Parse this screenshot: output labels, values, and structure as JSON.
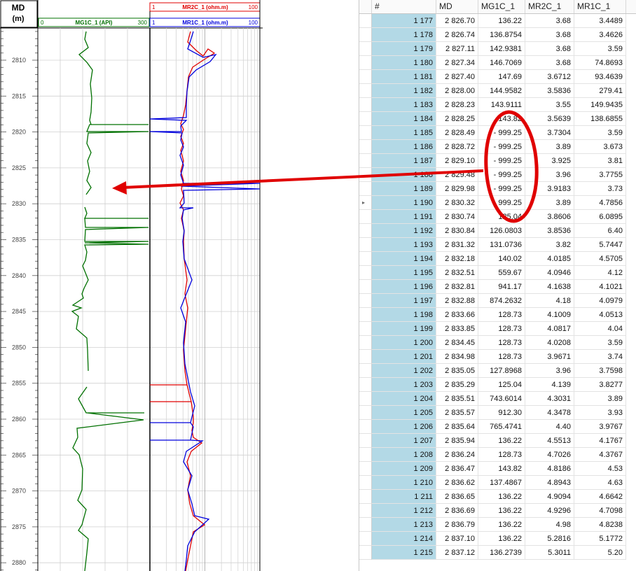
{
  "log": {
    "md_header": "MD",
    "md_unit": "(m)",
    "track1": {
      "min": "0",
      "name": "MG1C_1 (API)",
      "max": "300",
      "color": "#007000"
    },
    "track2_top": {
      "min": "1",
      "name": "MR2C_1 (ohm.m)",
      "max": "100",
      "color": "#e00000"
    },
    "track2_bottom": {
      "min": "1",
      "name": "MR1C_1 (ohm.m)",
      "max": "100",
      "color": "#0000dd"
    },
    "depth_labels": [
      "2810",
      "2815",
      "2820",
      "2825",
      "2830",
      "2835",
      "2840",
      "2845",
      "2850",
      "2855",
      "2860",
      "2865",
      "2870",
      "2875",
      "2880"
    ]
  },
  "table": {
    "columns": [
      "#",
      "MD",
      "MG1C_1",
      "MR2C_1",
      "MR1C_1"
    ],
    "current_row_marker": "▸",
    "rows": [
      [
        "1 177",
        "2 826.70",
        "136.22",
        "3.68",
        "3.4489"
      ],
      [
        "1 178",
        "2 826.74",
        "136.8754",
        "3.68",
        "3.4626"
      ],
      [
        "1 179",
        "2 827.11",
        "142.9381",
        "3.68",
        "3.59"
      ],
      [
        "1 180",
        "2 827.34",
        "146.7069",
        "3.68",
        "74.8693"
      ],
      [
        "1 181",
        "2 827.40",
        "147.69",
        "3.6712",
        "93.4639"
      ],
      [
        "1 182",
        "2 828.00",
        "144.9582",
        "3.5836",
        "279.41"
      ],
      [
        "1 183",
        "2 828.23",
        "143.9111",
        "3.55",
        "149.9435"
      ],
      [
        "1 184",
        "2 828.25",
        "143.82",
        "3.5639",
        "138.6855"
      ],
      [
        "1 185",
        "2 828.49",
        "- 999.25",
        "3.7304",
        "3.59"
      ],
      [
        "1 186",
        "2 828.72",
        "- 999.25",
        "3.89",
        "3.673"
      ],
      [
        "1 187",
        "2 829.10",
        "- 999.25",
        "3.925",
        "3.81"
      ],
      [
        "1 188",
        "2 829.48",
        "- 999.25",
        "3.96",
        "3.7755"
      ],
      [
        "1 189",
        "2 829.98",
        "- 999.25",
        "3.9183",
        "3.73"
      ],
      [
        "1 190",
        "2 830.32",
        "- 999.25",
        "3.89",
        "4.7856"
      ],
      [
        "1 191",
        "2 830.74",
        "125.04",
        "3.8606",
        "6.0895"
      ],
      [
        "1 192",
        "2 830.84",
        "126.0803",
        "3.8536",
        "6.40"
      ],
      [
        "1 193",
        "2 831.32",
        "131.0736",
        "3.82",
        "5.7447"
      ],
      [
        "1 194",
        "2 832.18",
        "140.02",
        "4.0185",
        "4.5705"
      ],
      [
        "1 195",
        "2 832.51",
        "559.67",
        "4.0946",
        "4.12"
      ],
      [
        "1 196",
        "2 832.81",
        "941.17",
        "4.1638",
        "4.1021"
      ],
      [
        "1 197",
        "2 832.88",
        "874.2632",
        "4.18",
        "4.0979"
      ],
      [
        "1 198",
        "2 833.66",
        "128.73",
        "4.1009",
        "4.0513"
      ],
      [
        "1 199",
        "2 833.85",
        "128.73",
        "4.0817",
        "4.04"
      ],
      [
        "1 200",
        "2 834.45",
        "128.73",
        "4.0208",
        "3.59"
      ],
      [
        "1 201",
        "2 834.98",
        "128.73",
        "3.9671",
        "3.74"
      ],
      [
        "1 202",
        "2 835.05",
        "127.8968",
        "3.96",
        "3.7598"
      ],
      [
        "1 203",
        "2 835.29",
        "125.04",
        "4.139",
        "3.8277"
      ],
      [
        "1 204",
        "2 835.51",
        "743.6014",
        "4.3031",
        "3.89"
      ],
      [
        "1 205",
        "2 835.57",
        "912.30",
        "4.3478",
        "3.93"
      ],
      [
        "1 206",
        "2 835.64",
        "765.4741",
        "4.40",
        "3.9767"
      ],
      [
        "1 207",
        "2 835.94",
        "136.22",
        "4.5513",
        "4.1767"
      ],
      [
        "1 208",
        "2 836.24",
        "128.73",
        "4.7026",
        "4.3767"
      ],
      [
        "1 209",
        "2 836.47",
        "143.82",
        "4.8186",
        "4.53"
      ],
      [
        "1 210",
        "2 836.62",
        "137.4867",
        "4.8943",
        "4.63"
      ],
      [
        "1 211",
        "2 836.65",
        "136.22",
        "4.9094",
        "4.6642"
      ],
      [
        "1 212",
        "2 836.69",
        "136.22",
        "4.9296",
        "4.7098"
      ],
      [
        "1 213",
        "2 836.79",
        "136.22",
        "4.98",
        "4.8238"
      ],
      [
        "1 214",
        "2 837.10",
        "136.22",
        "5.2816",
        "5.1772"
      ],
      [
        "1 215",
        "2 837.12",
        "136.2739",
        "5.3011",
        "5.20"
      ]
    ]
  },
  "annotation": {
    "color": "#e00000"
  }
}
